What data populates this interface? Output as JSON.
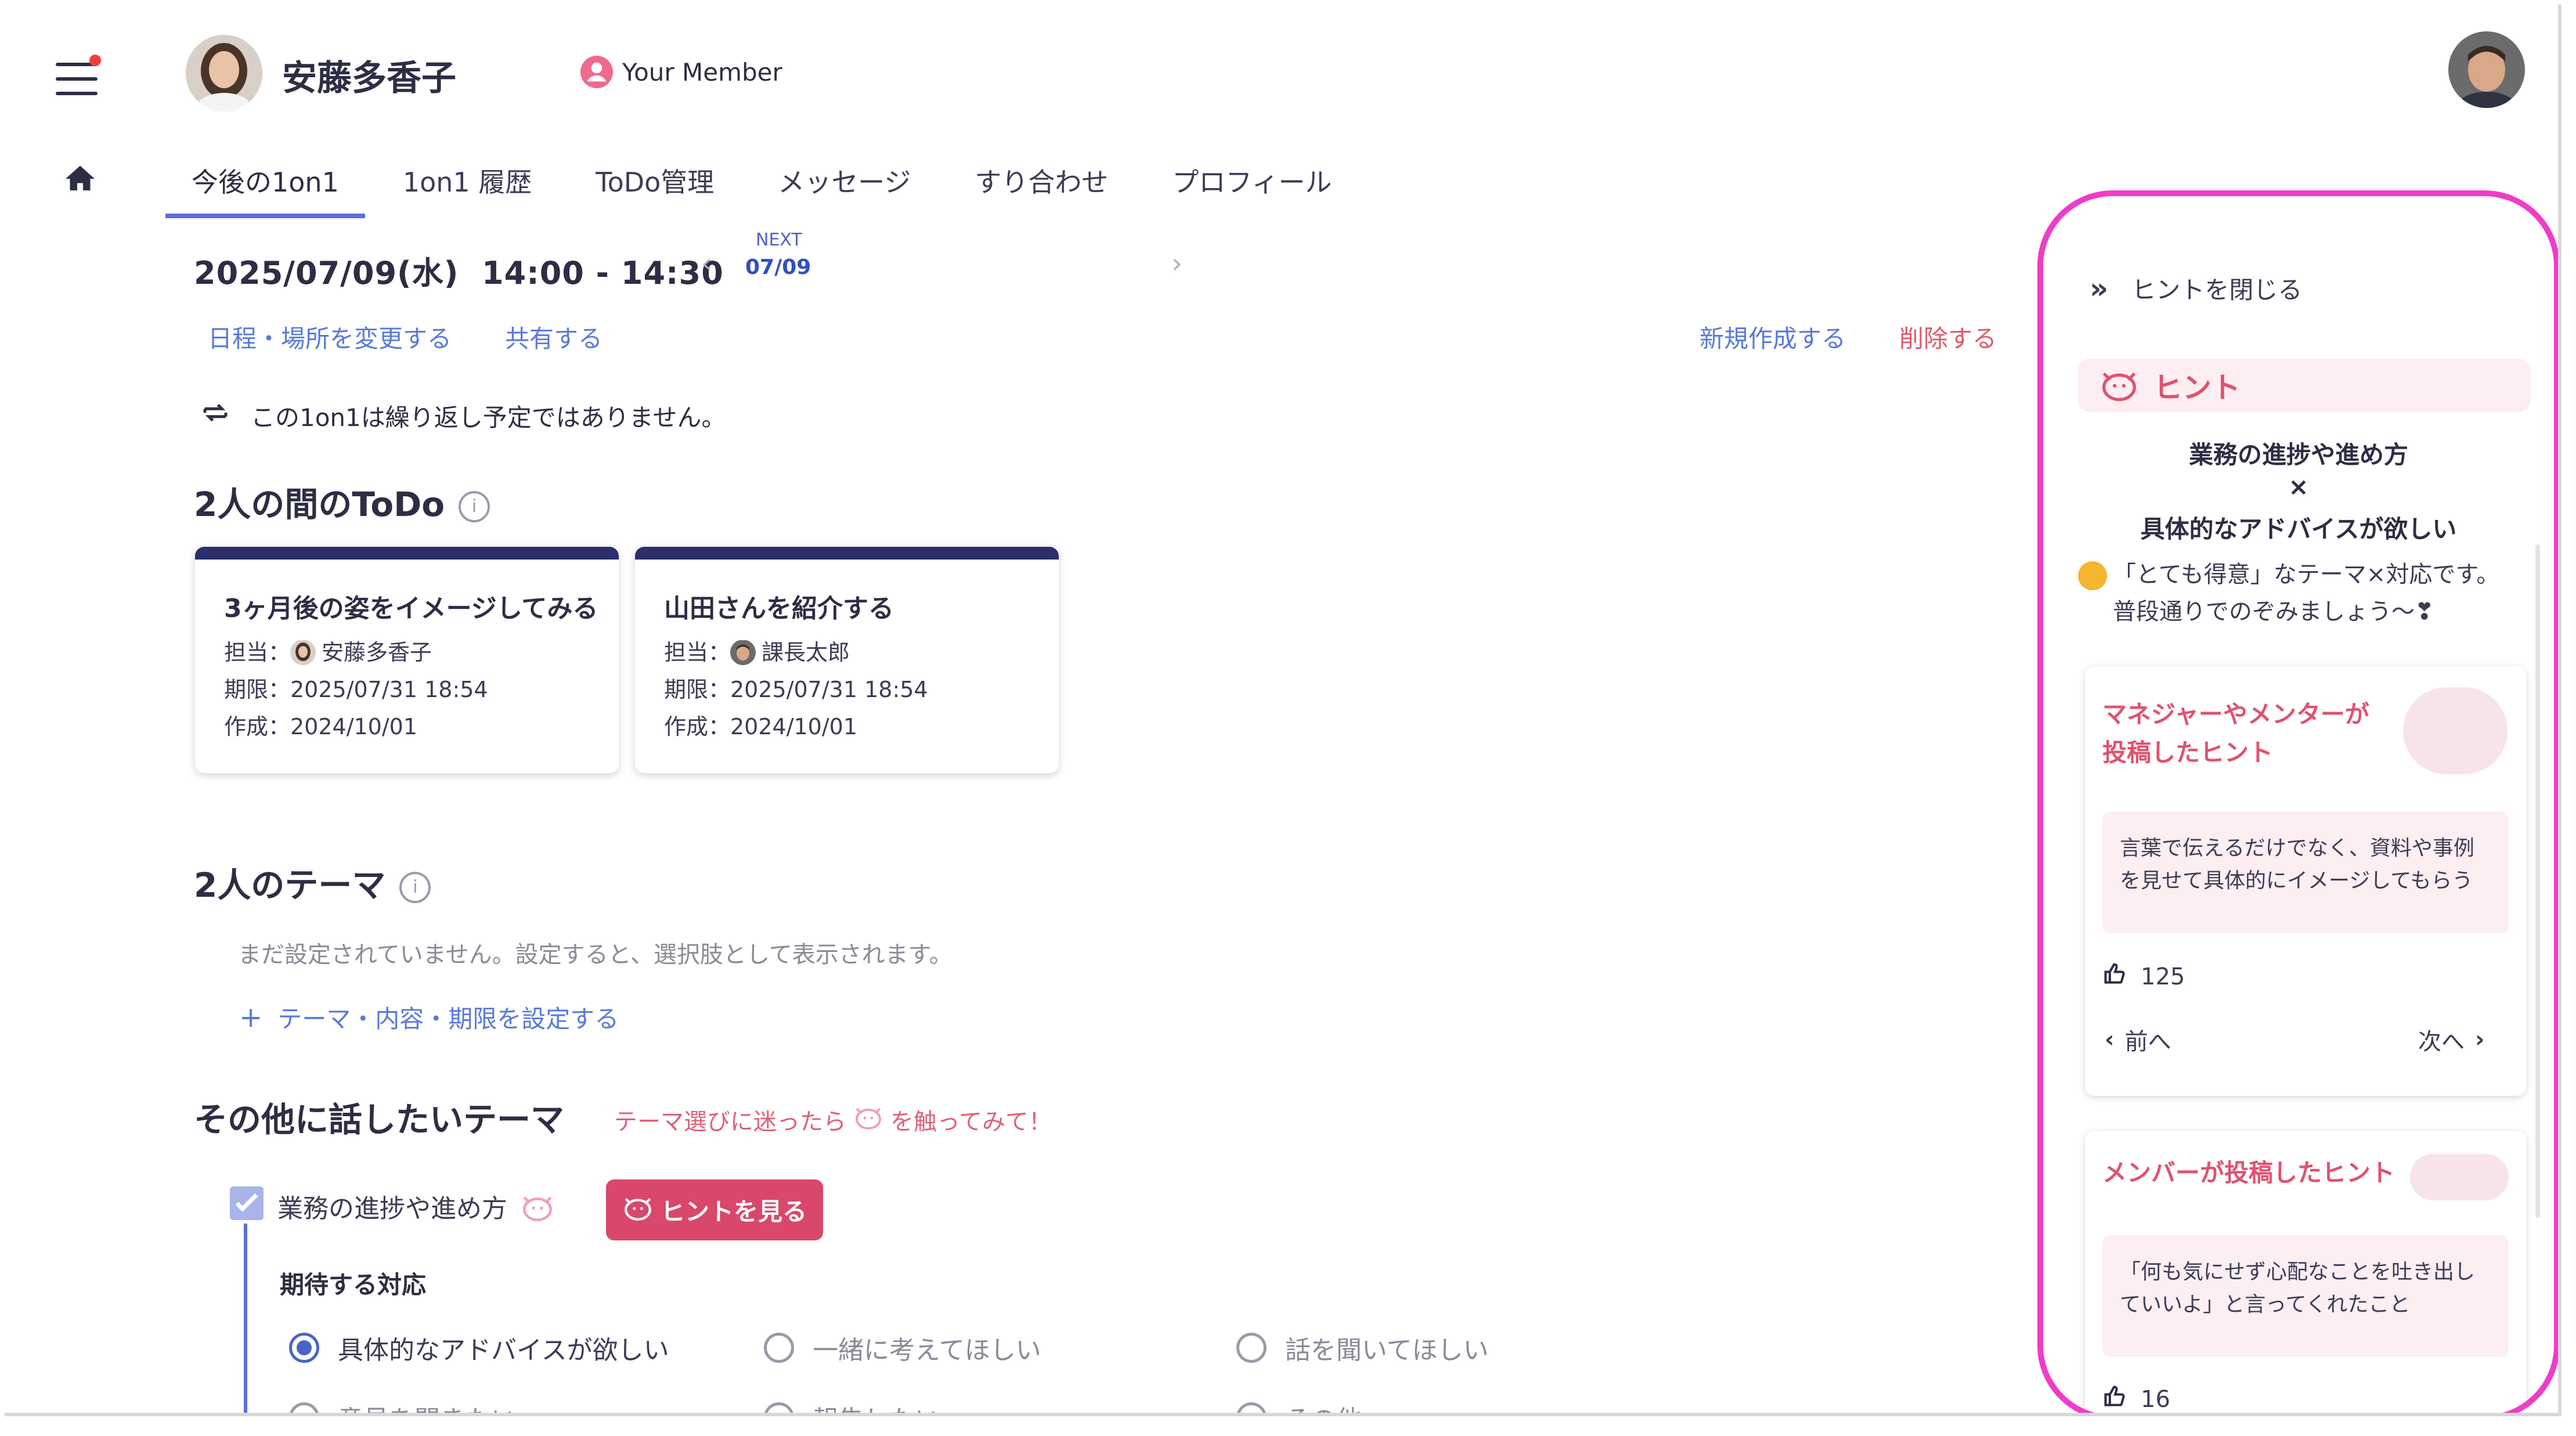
{
  "header": {
    "user_name": "安藤多香子",
    "member_badge": "Your Member"
  },
  "tabs": [
    "今後の1on1",
    "1on1 履歴",
    "ToDo管理",
    "メッセージ",
    "すり合わせ",
    "プロフィール"
  ],
  "schedule": {
    "datetime": "2025/07/09(水)  14:00 - 14:30",
    "next_label": "NEXT",
    "next_date": "07/09",
    "change_link": "日程・場所を変更する",
    "share_link": "共有する",
    "new_link": "新規作成する",
    "delete_link": "削除する",
    "repeat_note": "この1on1は繰り返し予定ではありません。"
  },
  "todo_section": {
    "title": "2人の間のToDo",
    "cards": [
      {
        "title": "3ヶ月後の姿をイメージしてみる",
        "assignee_label": "担当：",
        "assignee": "安藤多香子",
        "due": "期限：2025/07/31 18:54",
        "created": "作成：2024/10/01"
      },
      {
        "title": "山田さんを紹介する",
        "assignee_label": "担当：",
        "assignee": "課長太郎",
        "due": "期限：2025/07/31 18:54",
        "created": "作成：2024/10/01"
      }
    ]
  },
  "theme_section": {
    "title": "2人のテーマ",
    "empty_note": "まだ設定されていません。設定すると、選択肢として表示されます。",
    "add_link": "テーマ・内容・期限を設定する"
  },
  "other_section": {
    "title": "その他に話したいテーマ",
    "tip_pre": "テーマ選びに迷ったら",
    "tip_post": "を触ってみて！",
    "topic_label": "業務の進捗や進め方",
    "hint_button": "ヒントを見る",
    "expect_label": "期待する対応",
    "options": [
      "具体的なアドバイスが欲しい",
      "一緒に考えてほしい",
      "話を聞いてほしい",
      "意見を聞きたい",
      "報告したい",
      "その他"
    ],
    "selected": 0
  },
  "hint_panel": {
    "close_label": "ヒントを閉じる",
    "header": "ヒント",
    "topic": "業務の進捗や進め方",
    "times": "×",
    "need": "具体的なアドバイスが欲しい",
    "comment_line1": "「とても得意」なテーマ×対応です。",
    "comment_line2": "普段通りでのぞみましょう〜❣",
    "cards": [
      {
        "title_line1": "マネジャーやメンターが",
        "title_line2": "投稿したヒント",
        "quote": "言葉で伝えるだけでなく、資料や事例を見せて具体的にイメージしてもらう",
        "likes": "125",
        "prev": "前へ",
        "next": "次へ"
      },
      {
        "title_line1": "メンバーが投稿したヒント",
        "quote": "「何も気にせず心配なことを吐き出していいよ」と言ってくれたこと",
        "likes": "16"
      }
    ]
  },
  "colors": {
    "accent_blue": "#5b6fd8",
    "navy": "#2c2f6b",
    "pink": "#e0526e",
    "highlight_border": "#f03cc8"
  }
}
